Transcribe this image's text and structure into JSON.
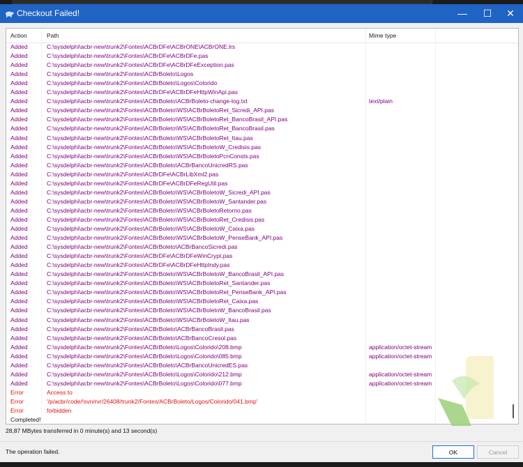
{
  "window": {
    "title": "Checkout Failed!",
    "min": "—",
    "max": "☐",
    "close": "✕"
  },
  "columns": {
    "action": "Action",
    "path": "Path",
    "mime": "Mime type"
  },
  "rows": [
    {
      "action": "Added",
      "path": "C:\\sysdelphi\\acbr-new\\trunk2\\Fontes\\ACBrDFe\\ACBrONE\\ACBrONE.lrs",
      "mime": "",
      "kind": "added"
    },
    {
      "action": "Added",
      "path": "C:\\sysdelphi\\acbr-new\\trunk2\\Fontes\\ACBrDFe\\ACBrDFe.pas",
      "mime": "",
      "kind": "added"
    },
    {
      "action": "Added",
      "path": "C:\\sysdelphi\\acbr-new\\trunk2\\Fontes\\ACBrDFe\\ACBrDFeException.pas",
      "mime": "",
      "kind": "added"
    },
    {
      "action": "Added",
      "path": "C:\\sysdelphi\\acbr-new\\trunk2\\Fontes\\ACBrBoleto\\Logos",
      "mime": "",
      "kind": "added"
    },
    {
      "action": "Added",
      "path": "C:\\sysdelphi\\acbr-new\\trunk2\\Fontes\\ACBrBoleto\\Logos\\Colorido",
      "mime": "",
      "kind": "added"
    },
    {
      "action": "Added",
      "path": "C:\\sysdelphi\\acbr-new\\trunk2\\Fontes\\ACBrDFe\\ACBrDFeHttpWinApi.pas",
      "mime": "",
      "kind": "added"
    },
    {
      "action": "Added",
      "path": "C:\\sysdelphi\\acbr-new\\trunk2\\Fontes\\ACBrBoleto\\ACBrBoleto-change-log.txt",
      "mime": "text/plain",
      "kind": "added"
    },
    {
      "action": "Added",
      "path": "C:\\sysdelphi\\acbr-new\\trunk2\\Fontes\\ACBrBoleto\\WS\\ACBrBoletoRet_Sicredi_API.pas",
      "mime": "",
      "kind": "added"
    },
    {
      "action": "Added",
      "path": "C:\\sysdelphi\\acbr-new\\trunk2\\Fontes\\ACBrBoleto\\WS\\ACBrBoletoRet_BancoBrasil_API.pas",
      "mime": "",
      "kind": "added"
    },
    {
      "action": "Added",
      "path": "C:\\sysdelphi\\acbr-new\\trunk2\\Fontes\\ACBrBoleto\\WS\\ACBrBoletoRet_BancoBrasil.pas",
      "mime": "",
      "kind": "added"
    },
    {
      "action": "Added",
      "path": "C:\\sysdelphi\\acbr-new\\trunk2\\Fontes\\ACBrBoleto\\WS\\ACBrBoletoRet_Itau.pas",
      "mime": "",
      "kind": "added"
    },
    {
      "action": "Added",
      "path": "C:\\sysdelphi\\acbr-new\\trunk2\\Fontes\\ACBrBoleto\\WS\\ACBrBoletoW_Credisis.pas",
      "mime": "",
      "kind": "added"
    },
    {
      "action": "Added",
      "path": "C:\\sysdelphi\\acbr-new\\trunk2\\Fontes\\ACBrBoleto\\WS\\ACBrBoletoPcnConsts.pas",
      "mime": "",
      "kind": "added"
    },
    {
      "action": "Added",
      "path": "C:\\sysdelphi\\acbr-new\\trunk2\\Fontes\\ACBrBoleto\\ACBrBancoUnicredRS.pas",
      "mime": "",
      "kind": "added"
    },
    {
      "action": "Added",
      "path": "C:\\sysdelphi\\acbr-new\\trunk2\\Fontes\\ACBrDFe\\ACBrLibXml2.pas",
      "mime": "",
      "kind": "added"
    },
    {
      "action": "Added",
      "path": "C:\\sysdelphi\\acbr-new\\trunk2\\Fontes\\ACBrDFe\\ACBrDFeRegUtil.pas",
      "mime": "",
      "kind": "added"
    },
    {
      "action": "Added",
      "path": "C:\\sysdelphi\\acbr-new\\trunk2\\Fontes\\ACBrBoleto\\WS\\ACBrBoletoW_Sicredi_API.pas",
      "mime": "",
      "kind": "added"
    },
    {
      "action": "Added",
      "path": "C:\\sysdelphi\\acbr-new\\trunk2\\Fontes\\ACBrBoleto\\WS\\ACBrBoletoW_Santander.pas",
      "mime": "",
      "kind": "added"
    },
    {
      "action": "Added",
      "path": "C:\\sysdelphi\\acbr-new\\trunk2\\Fontes\\ACBrBoleto\\WS\\ACBrBoletoRetorno.pas",
      "mime": "",
      "kind": "added"
    },
    {
      "action": "Added",
      "path": "C:\\sysdelphi\\acbr-new\\trunk2\\Fontes\\ACBrBoleto\\WS\\ACBrBoletoRet_Credisis.pas",
      "mime": "",
      "kind": "added"
    },
    {
      "action": "Added",
      "path": "C:\\sysdelphi\\acbr-new\\trunk2\\Fontes\\ACBrBoleto\\WS\\ACBrBoletoW_Caixa.pas",
      "mime": "",
      "kind": "added"
    },
    {
      "action": "Added",
      "path": "C:\\sysdelphi\\acbr-new\\trunk2\\Fontes\\ACBrBoleto\\WS\\ACBrBoletoW_PenseBank_API.pas",
      "mime": "",
      "kind": "added"
    },
    {
      "action": "Added",
      "path": "C:\\sysdelphi\\acbr-new\\trunk2\\Fontes\\ACBrBoleto\\ACBrBancoSicredi.pas",
      "mime": "",
      "kind": "added"
    },
    {
      "action": "Added",
      "path": "C:\\sysdelphi\\acbr-new\\trunk2\\Fontes\\ACBrDFe\\ACBrDFeWinCrypt.pas",
      "mime": "",
      "kind": "added"
    },
    {
      "action": "Added",
      "path": "C:\\sysdelphi\\acbr-new\\trunk2\\Fontes\\ACBrDFe\\ACBrDFeHttpIndy.pas",
      "mime": "",
      "kind": "added"
    },
    {
      "action": "Added",
      "path": "C:\\sysdelphi\\acbr-new\\trunk2\\Fontes\\ACBrBoleto\\WS\\ACBrBoletoW_BancoBrasil_API.pas",
      "mime": "",
      "kind": "added"
    },
    {
      "action": "Added",
      "path": "C:\\sysdelphi\\acbr-new\\trunk2\\Fontes\\ACBrBoleto\\WS\\ACBrBoletoRet_Santander.pas",
      "mime": "",
      "kind": "added"
    },
    {
      "action": "Added",
      "path": "C:\\sysdelphi\\acbr-new\\trunk2\\Fontes\\ACBrBoleto\\WS\\ACBrBoletoRet_PenseBank_API.pas",
      "mime": "",
      "kind": "added"
    },
    {
      "action": "Added",
      "path": "C:\\sysdelphi\\acbr-new\\trunk2\\Fontes\\ACBrBoleto\\WS\\ACBrBoletoRet_Caixa.pas",
      "mime": "",
      "kind": "added"
    },
    {
      "action": "Added",
      "path": "C:\\sysdelphi\\acbr-new\\trunk2\\Fontes\\ACBrBoleto\\WS\\ACBrBoletoW_BancoBrasil.pas",
      "mime": "",
      "kind": "added"
    },
    {
      "action": "Added",
      "path": "C:\\sysdelphi\\acbr-new\\trunk2\\Fontes\\ACBrBoleto\\WS\\ACBrBoletoW_Itau.pas",
      "mime": "",
      "kind": "added"
    },
    {
      "action": "Added",
      "path": "C:\\sysdelphi\\acbr-new\\trunk2\\Fontes\\ACBrBoleto\\ACBrBancoBrasil.pas",
      "mime": "",
      "kind": "added"
    },
    {
      "action": "Added",
      "path": "C:\\sysdelphi\\acbr-new\\trunk2\\Fontes\\ACBrBoleto\\ACBrBancoCresol.pas",
      "mime": "",
      "kind": "added"
    },
    {
      "action": "Added",
      "path": "C:\\sysdelphi\\acbr-new\\trunk2\\Fontes\\ACBrBoleto\\Logos\\Colorido\\208.bmp",
      "mime": "application/octet-stream",
      "kind": "added"
    },
    {
      "action": "Added",
      "path": "C:\\sysdelphi\\acbr-new\\trunk2\\Fontes\\ACBrBoleto\\Logos\\Colorido\\085.bmp",
      "mime": "application/octet-stream",
      "kind": "added"
    },
    {
      "action": "Added",
      "path": "C:\\sysdelphi\\acbr-new\\trunk2\\Fontes\\ACBrBoleto\\ACBrBancoUnicredES.pas",
      "mime": "",
      "kind": "added"
    },
    {
      "action": "Added",
      "path": "C:\\sysdelphi\\acbr-new\\trunk2\\Fontes\\ACBrBoleto\\Logos\\Colorido\\212.bmp",
      "mime": "application/octet-stream",
      "kind": "added"
    },
    {
      "action": "Added",
      "path": "C:\\sysdelphi\\acbr-new\\trunk2\\Fontes\\ACBrBoleto\\Logos\\Colorido\\077.bmp",
      "mime": "application/octet-stream",
      "kind": "added"
    },
    {
      "action": "Error",
      "path": "Access to",
      "mime": "",
      "kind": "error"
    },
    {
      "action": "Error",
      "path": " '/p/acbr/code/!svn/rvr/26408/trunk2/Fontes/ACBrBoleto/Logos/Colorido/041.bmp'",
      "mime": "",
      "kind": "error"
    },
    {
      "action": "Error",
      "path": " forbidden",
      "mime": "",
      "kind": "error"
    },
    {
      "action": "Completed!",
      "path": "",
      "mime": "",
      "kind": "done"
    }
  ],
  "status": {
    "transferred": "28,87 MBytes transferred in 0 minute(s) and 13 second(s)"
  },
  "footer": {
    "message": "The operation failed.",
    "ok": "OK",
    "cancel": "Cancel"
  },
  "colors": {
    "titlebar": "#1f63c4",
    "added": "#800080",
    "error": "#e01010"
  }
}
